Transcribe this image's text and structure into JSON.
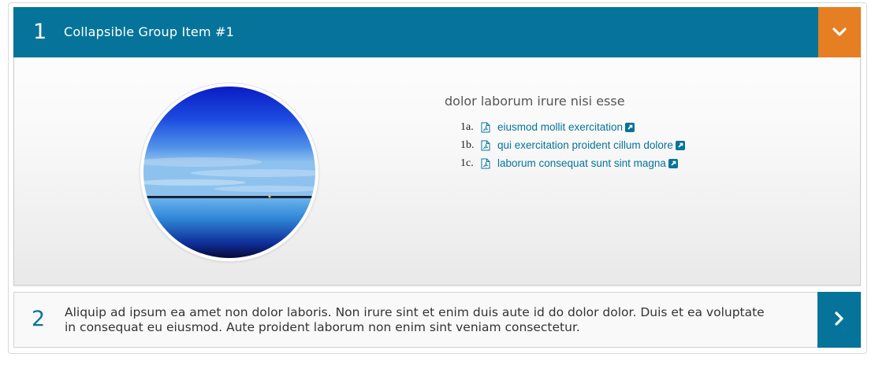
{
  "panel1": {
    "number": "1",
    "title": "Collapsible Group Item #1",
    "toggle_icon": "chevron-down-icon",
    "section_heading": "dolor laborum irure nisi esse",
    "documents": [
      {
        "index": "1a.",
        "label": "eiusmod mollit exercitation"
      },
      {
        "index": "1b.",
        "label": "qui exercitation proident cillum dolore"
      },
      {
        "index": "1c.",
        "label": "laborum consequat sunt sint magna"
      }
    ]
  },
  "panel2": {
    "number": "2",
    "text": "Aliquip ad ipsum ea amet non dolor laboris. Non irure sint et enim duis aute id do dolor dolor. Duis et ea voluptate in consequat eu eiusmod. Aute proident laborum non enim sint veniam consectetur.",
    "toggle_icon": "chevron-right-icon"
  },
  "colors": {
    "header_teal": "#06749a",
    "toggle_orange": "#e67e22",
    "link": "#06749a"
  }
}
